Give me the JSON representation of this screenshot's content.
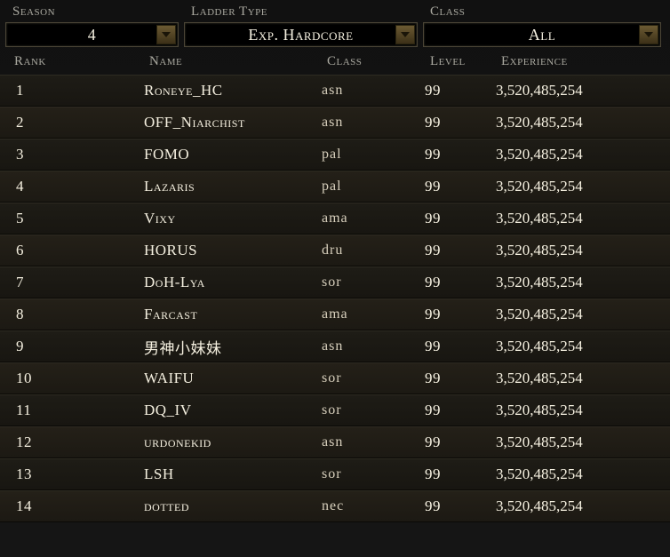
{
  "filters": {
    "season": {
      "label": "Season",
      "value": "4"
    },
    "ladder": {
      "label": "Ladder Type",
      "value": "Exp. Hardcore"
    },
    "classsel": {
      "label": "Class",
      "value": "All"
    }
  },
  "columns": {
    "rank": "Rank",
    "name": "Name",
    "class": "Class",
    "level": "Level",
    "experience": "Experience"
  },
  "rows": [
    {
      "rank": "1",
      "name": "Roneye_HC",
      "class": "asn",
      "level": "99",
      "exp": "3,520,485,254"
    },
    {
      "rank": "2",
      "name": "OFF_Niarchist",
      "class": "asn",
      "level": "99",
      "exp": "3,520,485,254"
    },
    {
      "rank": "3",
      "name": "FOMO",
      "class": "pal",
      "level": "99",
      "exp": "3,520,485,254"
    },
    {
      "rank": "4",
      "name": "Lazaris",
      "class": "pal",
      "level": "99",
      "exp": "3,520,485,254"
    },
    {
      "rank": "5",
      "name": "Vixy",
      "class": "ama",
      "level": "99",
      "exp": "3,520,485,254"
    },
    {
      "rank": "6",
      "name": "HORUS",
      "class": "dru",
      "level": "99",
      "exp": "3,520,485,254"
    },
    {
      "rank": "7",
      "name": "DoH-Lya",
      "class": "sor",
      "level": "99",
      "exp": "3,520,485,254"
    },
    {
      "rank": "8",
      "name": "Farcast",
      "class": "ama",
      "level": "99",
      "exp": "3,520,485,254"
    },
    {
      "rank": "9",
      "name": "男神小妹妹",
      "class": "asn",
      "level": "99",
      "exp": "3,520,485,254"
    },
    {
      "rank": "10",
      "name": "WAIFU",
      "class": "sor",
      "level": "99",
      "exp": "3,520,485,254"
    },
    {
      "rank": "11",
      "name": "DQ_IV",
      "class": "sor",
      "level": "99",
      "exp": "3,520,485,254"
    },
    {
      "rank": "12",
      "name": "urdonekid",
      "class": "asn",
      "level": "99",
      "exp": "3,520,485,254"
    },
    {
      "rank": "13",
      "name": "LSH",
      "class": "sor",
      "level": "99",
      "exp": "3,520,485,254"
    },
    {
      "rank": "14",
      "name": "dotted",
      "class": "nec",
      "level": "99",
      "exp": "3,520,485,254"
    }
  ]
}
